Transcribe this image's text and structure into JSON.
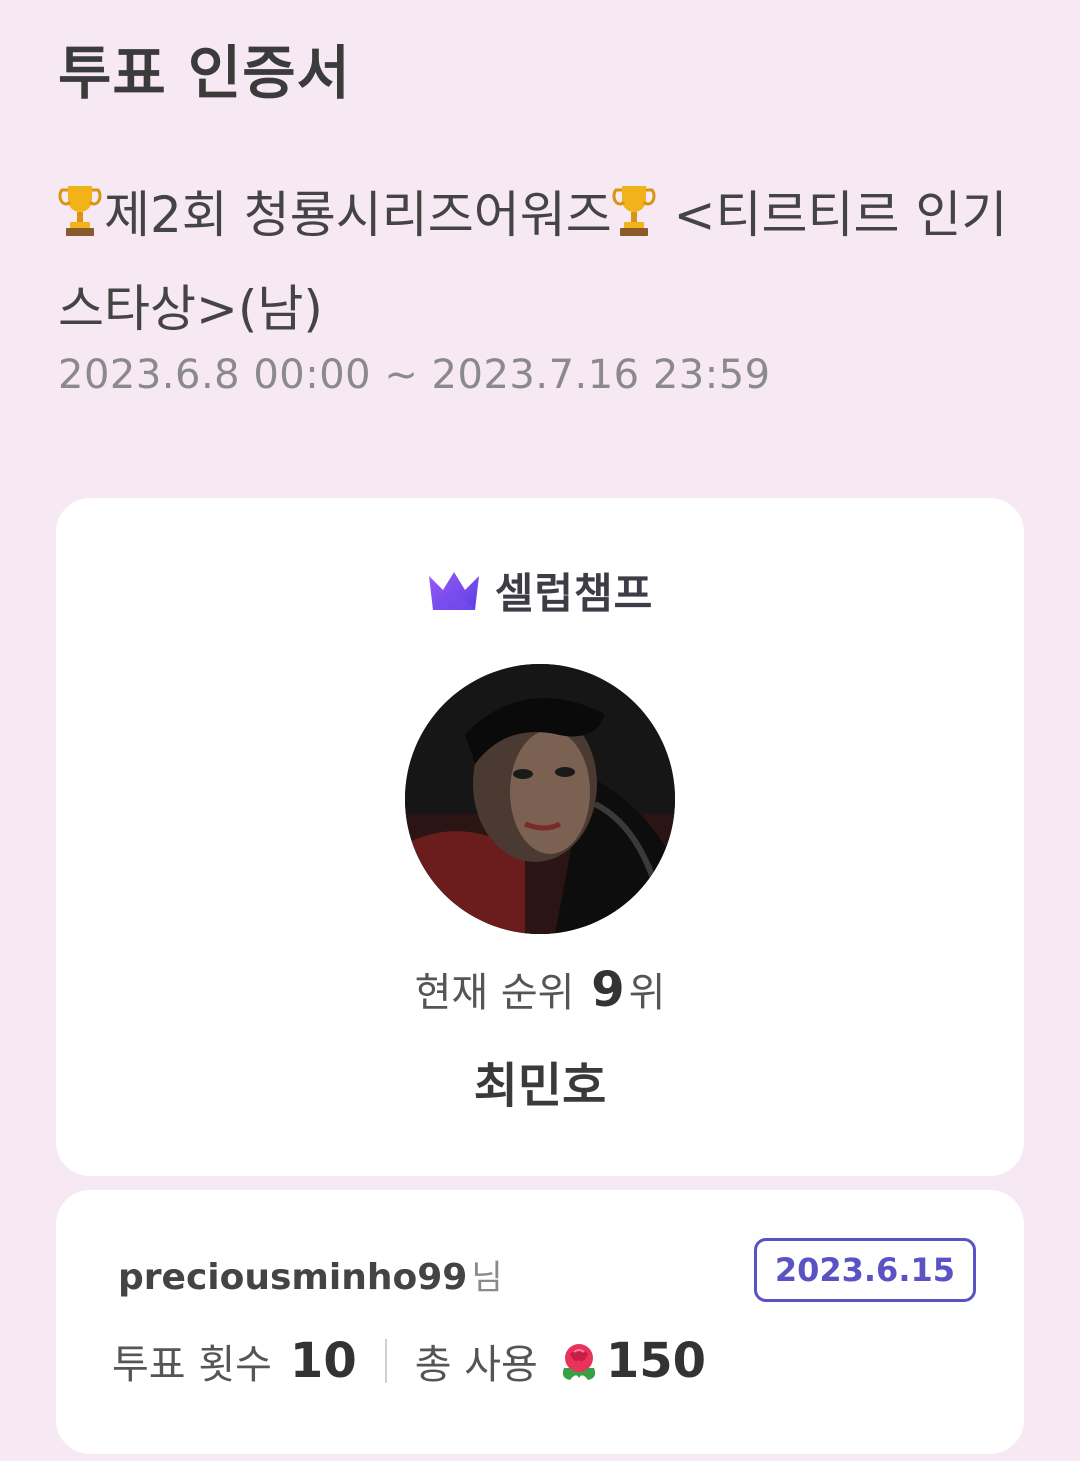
{
  "header": {
    "title": "투표 인증서"
  },
  "event": {
    "title_part1": "제2회 청룡시리즈어워즈",
    "title_part2": " <티르티르 인기스타상>(남)",
    "period": "2023.6.8 00:00 ~ 2023.7.16 23:59",
    "icon": "trophy-icon"
  },
  "brand": {
    "name": "셀럽챔프",
    "icon": "crown-icon",
    "color": "#7b4cf0"
  },
  "celebrity": {
    "rank_prefix": "현재 순위",
    "rank": "9",
    "rank_suffix": "위",
    "name": "최민호"
  },
  "voter": {
    "username": "preciousminho99",
    "honorific": "님",
    "date": "2023.6.15",
    "vote_count_label": "투표 횟수",
    "vote_count": "10",
    "total_used_label": "총 사용",
    "total_used": "150",
    "currency_icon": "rose-icon"
  },
  "colors": {
    "background": "#f7e9f3",
    "card": "#ffffff",
    "accent": "#5b52c4"
  }
}
